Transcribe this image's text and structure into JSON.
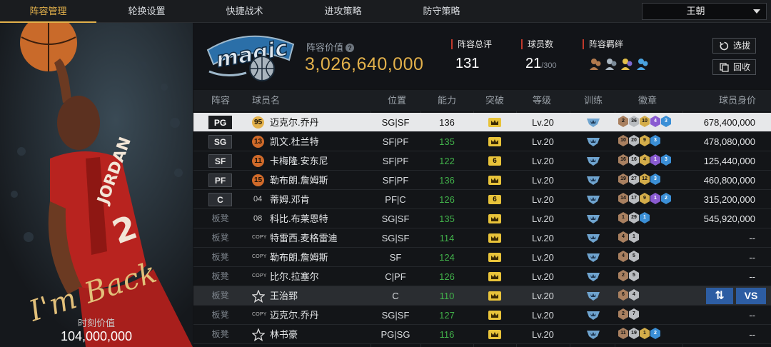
{
  "tabs": [
    {
      "label": "阵容管理",
      "active": true
    },
    {
      "label": "轮换设置",
      "active": false
    },
    {
      "label": "快捷战术",
      "active": false
    },
    {
      "label": "进攻策略",
      "active": false
    },
    {
      "label": "防守策略",
      "active": false
    }
  ],
  "dropdown": {
    "selected": "王朝"
  },
  "left_panel": {
    "signature": "I'm Back",
    "moment_label": "时刻价值",
    "moment_value": "104,000,000"
  },
  "header": {
    "lineup_value_label": "阵容价值",
    "lineup_value": "3,026,640,000",
    "total_rating_label": "阵容总评",
    "total_rating": "131",
    "player_count_label": "球员数",
    "player_count": "21",
    "player_count_max": "/300",
    "chemistry_label": "阵容羁绊",
    "select_button": "选拔",
    "recycle_button": "回收"
  },
  "columns": [
    "阵容",
    "球员名",
    "位置",
    "能力",
    "突破",
    "等级",
    "训练",
    "徽章",
    "球员身价"
  ],
  "rows": [
    {
      "slot": "PG",
      "bench": false,
      "badge_type": "gold",
      "badge": "95",
      "name": "迈克尔.乔丹",
      "pos": "SG|SF",
      "ovr": "136",
      "breakthrough": "crown",
      "level": "Lv.20",
      "badges": [
        [
          "br",
          "2"
        ],
        [
          "si",
          "36"
        ],
        [
          "go",
          "10"
        ],
        [
          "pu",
          "4"
        ],
        [
          "bl",
          "3"
        ]
      ],
      "value": "678,400,000",
      "selected": true
    },
    {
      "slot": "SG",
      "bench": false,
      "badge_type": "orange",
      "badge": "13",
      "name": "凯文.杜兰特",
      "pos": "SF|PF",
      "ovr": "135",
      "breakthrough": "crown",
      "level": "Lv.20",
      "badges": [
        [
          "br",
          "10"
        ],
        [
          "si",
          "20"
        ],
        [
          "go",
          "9"
        ],
        [
          "bl",
          "3"
        ]
      ],
      "value": "478,080,000"
    },
    {
      "slot": "SF",
      "bench": false,
      "badge_type": "orange",
      "badge": "11",
      "name": "卡梅隆.安东尼",
      "pos": "SF|PF",
      "ovr": "122",
      "breakthrough": "6",
      "level": "Lv.20",
      "badges": [
        [
          "br",
          "16"
        ],
        [
          "si",
          "16"
        ],
        [
          "go",
          "4"
        ],
        [
          "pu",
          "1"
        ],
        [
          "bl",
          "3"
        ]
      ],
      "value": "125,440,000"
    },
    {
      "slot": "PF",
      "bench": false,
      "badge_type": "orange",
      "badge": "15",
      "name": "勒布朗.詹姆斯",
      "pos": "SF|PF",
      "ovr": "136",
      "breakthrough": "crown",
      "level": "Lv.20",
      "badges": [
        [
          "br",
          "19"
        ],
        [
          "si",
          "27"
        ],
        [
          "go",
          "12"
        ],
        [
          "bl",
          "3"
        ]
      ],
      "value": "460,800,000"
    },
    {
      "slot": "C",
      "bench": false,
      "badge_type": "plain",
      "badge": "04",
      "name": "蒂姆.邓肯",
      "pos": "PF|C",
      "ovr": "126",
      "breakthrough": "6",
      "level": "Lv.20",
      "badges": [
        [
          "br",
          "14"
        ],
        [
          "si",
          "17"
        ],
        [
          "go",
          "9"
        ],
        [
          "pu",
          "1"
        ],
        [
          "bl",
          "2"
        ]
      ],
      "value": "315,200,000"
    },
    {
      "slot": "板凳",
      "bench": true,
      "badge_type": "plain",
      "badge": "08",
      "name": "科比.布莱恩特",
      "pos": "SG|SF",
      "ovr": "135",
      "breakthrough": "crown",
      "level": "Lv.20",
      "badges": [
        [
          "br",
          "1"
        ],
        [
          "si",
          "29"
        ],
        [
          "bl",
          "1"
        ]
      ],
      "value": "545,920,000"
    },
    {
      "slot": "板凳",
      "bench": true,
      "badge_type": "copy",
      "badge": "COPY",
      "name": "特雷西.麦格雷迪",
      "pos": "SG|SF",
      "ovr": "114",
      "breakthrough": "crown",
      "level": "Lv.20",
      "badges": [
        [
          "br",
          "4"
        ],
        [
          "si",
          "1"
        ]
      ],
      "value": "--"
    },
    {
      "slot": "板凳",
      "bench": true,
      "badge_type": "copy",
      "badge": "COPY",
      "name": "勒布朗.詹姆斯",
      "pos": "SF",
      "ovr": "124",
      "breakthrough": "crown",
      "level": "Lv.20",
      "badges": [
        [
          "br",
          "4"
        ],
        [
          "si",
          "5"
        ]
      ],
      "value": "--"
    },
    {
      "slot": "板凳",
      "bench": true,
      "badge_type": "copy",
      "badge": "COPY",
      "name": "比尔.拉塞尔",
      "pos": "C|PF",
      "ovr": "126",
      "breakthrough": "crown",
      "level": "Lv.20",
      "badges": [
        [
          "br",
          "2"
        ],
        [
          "si",
          "5"
        ]
      ],
      "value": "--"
    },
    {
      "slot": "板凳",
      "bench": true,
      "badge_type": "star",
      "badge": "",
      "name": "王治郅",
      "pos": "C",
      "ovr": "110",
      "breakthrough": "crown",
      "level": "Lv.20",
      "badges": [
        [
          "br",
          "6"
        ],
        [
          "si",
          "4"
        ]
      ],
      "value": "",
      "highlight": true,
      "swap_label": "⇅",
      "vs_label": "VS"
    },
    {
      "slot": "板凳",
      "bench": true,
      "badge_type": "copy",
      "badge": "COPY",
      "name": "迈克尔.乔丹",
      "pos": "SG|SF",
      "ovr": "127",
      "breakthrough": "crown",
      "level": "Lv.20",
      "badges": [
        [
          "br",
          "2"
        ],
        [
          "si",
          "7"
        ]
      ],
      "value": "--"
    },
    {
      "slot": "板凳",
      "bench": true,
      "badge_type": "star",
      "badge": "",
      "name": "林书豪",
      "pos": "PG|SG",
      "ovr": "116",
      "breakthrough": "crown",
      "level": "Lv.20",
      "badges": [
        [
          "br",
          "11"
        ],
        [
          "si",
          "19"
        ],
        [
          "go",
          "1"
        ],
        [
          "bl",
          "2"
        ]
      ],
      "value": "--"
    }
  ]
}
